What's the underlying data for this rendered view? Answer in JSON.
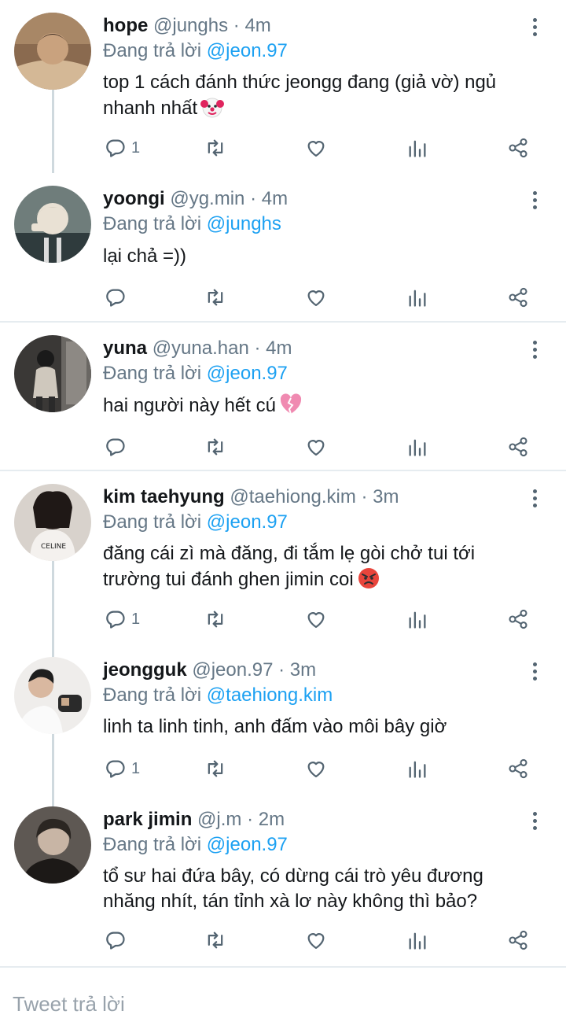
{
  "reply_prefix": "Đang trả lời",
  "reply_box": {
    "placeholder": "Tweet trả lời"
  },
  "tweets": [
    {
      "name": "hope",
      "handle": "@junghs",
      "separator": "·",
      "time": "4m",
      "replying_to": "@jeon.97",
      "lines": [
        "top 1 cách đánh thức jeongg đang (giả vờ) ngủ",
        "nhanh nhất"
      ],
      "emoji": "clown-face",
      "reply_count": "1",
      "avatar_colors": [
        "#6b4f3a",
        "#c9a27e",
        "#3a2a20"
      ]
    },
    {
      "name": "yoongi",
      "handle": "@yg.min",
      "separator": "·",
      "time": "4m",
      "replying_to": "@junghs",
      "lines": [
        "lại chả =))"
      ],
      "emoji": "",
      "reply_count": "",
      "avatar_colors": [
        "#7d8c8a",
        "#e3ddd2",
        "#3b4a4c"
      ]
    },
    {
      "name": "yuna",
      "handle": "@yuna.han",
      "separator": "·",
      "time": "4m",
      "replying_to": "@jeon.97",
      "lines": [
        "hai người này hết cú"
      ],
      "emoji": "broken-heart",
      "reply_count": "",
      "avatar_colors": [
        "#2a2a2a",
        "#c7c0b5",
        "#111111"
      ]
    },
    {
      "name": "kim taehyung",
      "handle": "@taehiong.kim",
      "separator": "·",
      "time": "3m",
      "replying_to": "@jeon.97",
      "lines": [
        "đăng cái zì mà đăng, đi tắm lẹ gòi chở tui tới",
        "trường tui đánh ghen jimin coi"
      ],
      "emoji": "angry-face",
      "reply_count": "1",
      "avatar_colors": [
        "#3a2f2b",
        "#efe9e4",
        "#1a1412"
      ]
    },
    {
      "name": "jeongguk",
      "handle": "@jeon.97",
      "separator": "·",
      "time": "3m",
      "replying_to": "@taehiong.kim",
      "lines": [
        "linh ta linh tinh, anh đấm vào môi bây giờ"
      ],
      "emoji": "",
      "reply_count": "1",
      "avatar_colors": [
        "#f2f0ee",
        "#d9b8a0",
        "#222222"
      ]
    },
    {
      "name": "park jimin",
      "handle": "@j.m",
      "separator": "·",
      "time": "2m",
      "replying_to": "@jeon.97",
      "lines": [
        "tổ sư hai đứa bây, có dừng cái trò yêu đương",
        "nhăng nhít, tán tỉnh xà lơ này không thì bảo?"
      ],
      "emoji": "",
      "reply_count": "",
      "avatar_colors": [
        "#3a3532",
        "#b9a89a",
        "#1a1715"
      ]
    }
  ],
  "icons": [
    "more-icon",
    "reply-icon",
    "retweet-icon",
    "like-icon",
    "analytics-icon",
    "share-icon"
  ]
}
